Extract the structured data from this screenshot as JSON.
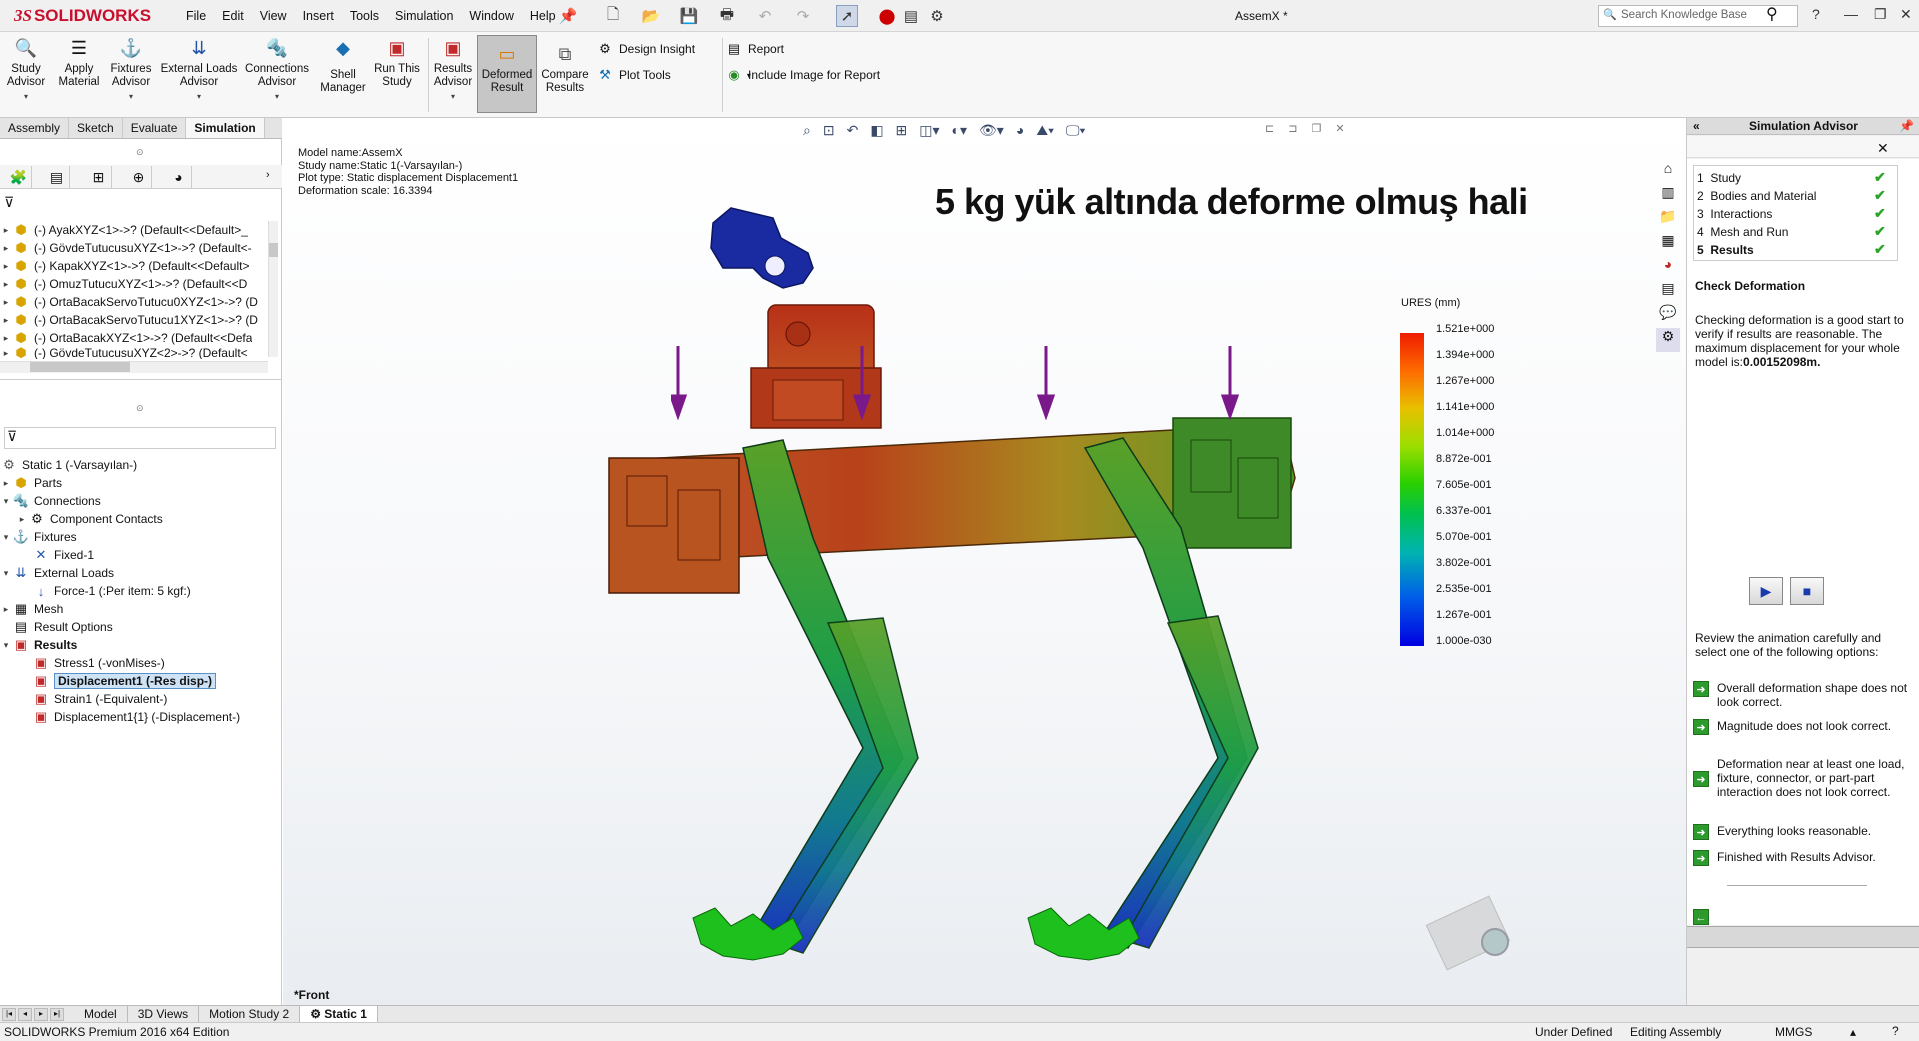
{
  "app": {
    "brand": "SOLIDWORKS",
    "document_title": "AssemX *"
  },
  "menu": [
    "File",
    "Edit",
    "View",
    "Insert",
    "Tools",
    "Simulation",
    "Window",
    "Help"
  ],
  "search": {
    "placeholder": "Search Knowledge Base"
  },
  "ribbon": {
    "buttons": [
      {
        "label": "Study\nAdvisor",
        "icon": "study-advisor-icon"
      },
      {
        "label": "Apply\nMaterial",
        "icon": "apply-material-icon"
      },
      {
        "label": "Fixtures\nAdvisor",
        "icon": "fixtures-advisor-icon"
      },
      {
        "label": "External Loads\nAdvisor",
        "icon": "external-loads-icon"
      },
      {
        "label": "Connections\nAdvisor",
        "icon": "connections-advisor-icon"
      },
      {
        "label": "Shell\nManager",
        "icon": "shell-manager-icon"
      },
      {
        "label": "Run This\nStudy",
        "icon": "run-study-icon"
      },
      {
        "label": "Results\nAdvisor",
        "icon": "results-advisor-icon"
      },
      {
        "label": "Deformed\nResult",
        "icon": "deformed-result-icon"
      },
      {
        "label": "Compare\nResults",
        "icon": "compare-results-icon"
      }
    ],
    "design_insight": "Design Insight",
    "plot_tools": "Plot Tools",
    "report": "Report",
    "include_image": "Include Image for Report"
  },
  "tabs": [
    "Assembly",
    "Sketch",
    "Evaluate",
    "Simulation"
  ],
  "tree_top": [
    "(-) AyakXYZ<1>->? (Default<<Default>_",
    "(-) GövdeTutucusuXYZ<1>->? (Default<-",
    "(-) KapakXYZ<1>->? (Default<<Default>",
    "(-) OmuzTutucuXYZ<1>->? (Default<<D",
    "(-) OrtaBacakServoTutucu0XYZ<1>->? (D",
    "(-) OrtaBacakServoTutucu1XYZ<1>->? (D",
    "(-) OrtaBacakXYZ<1>->? (Default<<Defa",
    "(-) GövdeTutucusuXYZ<2>->? (Default<"
  ],
  "study_tree": {
    "study": "Static 1 (-Varsayılan-)",
    "parts": "Parts",
    "connections": "Connections",
    "component_contacts": "Component Contacts",
    "fixtures": "Fixtures",
    "fixed1": "Fixed-1",
    "external_loads": "External Loads",
    "force1": "Force-1 (:Per item: 5 kgf:)",
    "mesh": "Mesh",
    "result_options": "Result Options",
    "results": "Results",
    "stress1": "Stress1 (-vonMises-)",
    "displacement1": "Displacement1 (-Res disp-)",
    "strain1": "Strain1 (-Equivalent-)",
    "displacement1_1": "Displacement1{1} (-Displacement-)"
  },
  "viewport": {
    "model_name": "Model name:AssemX",
    "study_name": "Study name:Static 1(-Varsayılan-)",
    "plot_type": "Plot type: Static displacement Displacement1",
    "deformation_scale": "Deformation scale: 16.3394",
    "headline": "5 kg yük altında deforme olmuş hali",
    "view_name": "*Front"
  },
  "legend": {
    "title": "URES (mm)",
    "values": [
      "1.521e+000",
      "1.394e+000",
      "1.267e+000",
      "1.141e+000",
      "1.014e+000",
      "8.872e-001",
      "7.605e-001",
      "6.337e-001",
      "5.070e-001",
      "3.802e-001",
      "2.535e-001",
      "1.267e-001",
      "1.000e-030"
    ]
  },
  "bottom_tabs": [
    "Model",
    "3D Views",
    "Motion Study 2",
    "Static 1"
  ],
  "status": {
    "edition": "SOLIDWORKS Premium 2016 x64 Edition",
    "state": "Under Defined",
    "mode": "Editing Assembly",
    "units": "MMGS"
  },
  "advisor": {
    "title": "Simulation Advisor",
    "steps": [
      {
        "num": "1",
        "label": "Study"
      },
      {
        "num": "2",
        "label": "Bodies and Material"
      },
      {
        "num": "3",
        "label": "Interactions"
      },
      {
        "num": "4",
        "label": "Mesh and Run"
      },
      {
        "num": "5",
        "label": "Results"
      }
    ],
    "section": "Check Deformation",
    "body_text": "Checking deformation is a good start to verify if results are reasonable. The maximum displacement for your whole model is:",
    "max_value": "0.00152098m.",
    "review_text": "Review the animation carefully and select one of the following options:",
    "options": [
      "Overall deformation shape does not look correct.",
      "Magnitude does not look correct.",
      "Deformation near at least one load, fixture, connector, or part-part interaction does not look correct.",
      "Everything looks reasonable.",
      "Finished with Results Advisor."
    ]
  },
  "colors": {
    "brand": "#c8102e",
    "load_arrow": "#7a1a8a",
    "check": "#2aa52a"
  }
}
